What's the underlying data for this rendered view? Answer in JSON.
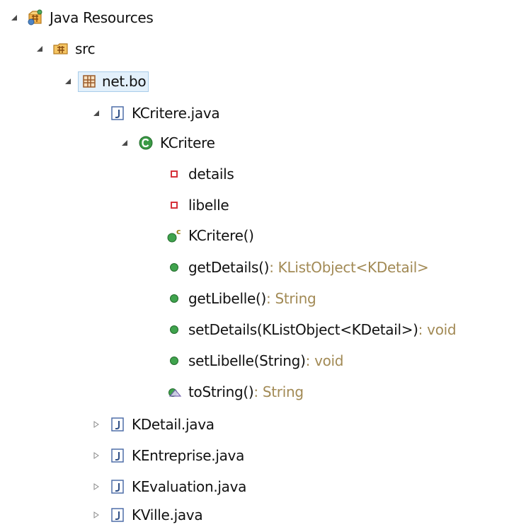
{
  "tree": {
    "java_resources": {
      "label": "Java Resources",
      "expanded": true,
      "icon": "java-resources-icon"
    },
    "src": {
      "label": "src",
      "expanded": true,
      "icon": "source-folder-icon"
    },
    "package": {
      "label": "net.bo",
      "expanded": true,
      "selected": true,
      "icon": "package-icon"
    },
    "files": [
      {
        "label": "KCritere.java",
        "expanded": true,
        "icon": "java-file-icon"
      },
      {
        "label": "KDetail.java",
        "expanded": false,
        "icon": "java-file-icon"
      },
      {
        "label": "KEntreprise.java",
        "expanded": false,
        "icon": "java-file-icon"
      },
      {
        "label": "KEvaluation.java",
        "expanded": false,
        "icon": "java-file-icon"
      },
      {
        "label": "KVille.java",
        "expanded": false,
        "icon": "java-file-icon"
      }
    ],
    "class": {
      "label": "KCritere",
      "expanded": true,
      "icon": "class-icon"
    },
    "members": [
      {
        "label": "details",
        "return": "",
        "kind": "private-field"
      },
      {
        "label": "libelle",
        "return": "",
        "kind": "private-field"
      },
      {
        "label": "KCritere()",
        "return": "",
        "kind": "constructor"
      },
      {
        "label": "getDetails()",
        "return": " : KListObject<KDetail>",
        "kind": "public-method"
      },
      {
        "label": "getLibelle()",
        "return": " : String",
        "kind": "public-method"
      },
      {
        "label": "setDetails(KListObject<KDetail>)",
        "return": " : void",
        "kind": "public-method"
      },
      {
        "label": "setLibelle(String)",
        "return": " : void",
        "kind": "public-method"
      },
      {
        "label": "toString()",
        "return": " : String",
        "kind": "override-method"
      }
    ]
  },
  "colors": {
    "selection_bg": "#e3f0fb",
    "selection_border": "#a9cdea",
    "return_type": "#a28a55",
    "private_field": "#d6323b",
    "public_method": "#3fa34d",
    "class_icon": "#3a9a45",
    "java_file_icon": "#4f6ea8",
    "package_icon": "#9a5a2a"
  }
}
